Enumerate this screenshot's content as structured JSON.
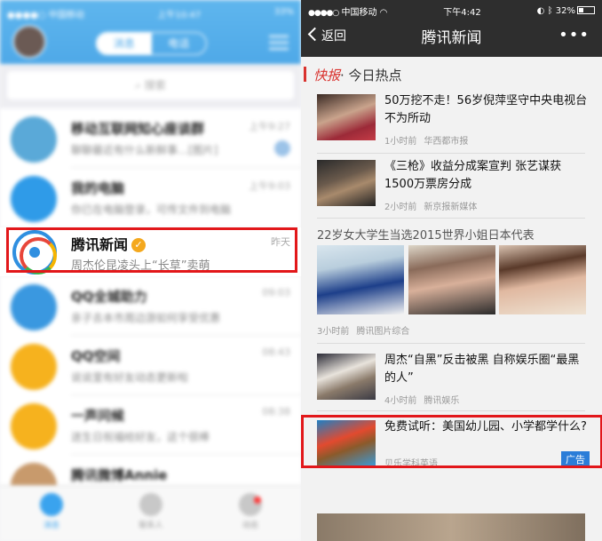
{
  "left": {
    "status": {
      "carrier": "●●●●○ 中国移动",
      "time": "上午10:47",
      "battery": "33%"
    },
    "segment": [
      "消息",
      "电话"
    ],
    "search_placeholder": "搜索",
    "items": [
      {
        "name": "移动互联网知心座谈群",
        "msg": "聊聊最近有什么新鲜事…[图片]",
        "time": "上午9:27"
      },
      {
        "name": "我的电脑",
        "msg": "你已在电脑登录，可传文件到电脑",
        "time": "上午9:03"
      },
      {
        "name": "QQ全城助力",
        "msg": "亲子去本市周边游如何享受优惠",
        "time": "09:03"
      },
      {
        "name": "QQ空间",
        "msg": "说说里有好友动态更新啦",
        "time": "08:43"
      },
      {
        "name": "一声问候",
        "msg": "送生日祝福给好友，这个很棒",
        "time": "08:38"
      },
      {
        "name": "腾讯微博Annie",
        "msg": "",
        "time": ""
      }
    ],
    "focused": {
      "name": "腾讯新闻",
      "msg": "周杰伦昆凌头上“长草”卖萌",
      "time": "昨天"
    },
    "tabs": [
      "消息",
      "联系人",
      "动态"
    ]
  },
  "right": {
    "status": {
      "carrier": "中国移动",
      "signal": "●●●●○",
      "time": "下午4:42",
      "battery": "32%"
    },
    "nav": {
      "back": "返回",
      "title": "腾讯新闻",
      "more": "•••"
    },
    "section": {
      "kuaibao": "快报",
      "title": "· 今日热点"
    },
    "news": [
      {
        "title": "50万挖不走！56岁倪萍坚守中央电视台不为所动",
        "time": "1小时前",
        "source": "华西都市报"
      },
      {
        "title": "《三枪》收益分成案宣判 张艺谋获1500万票房分成",
        "time": "2小时前",
        "source": "新京报新媒体"
      },
      {
        "title": "周杰“自黑”反击被黑 自称娱乐圈“最黑的人”",
        "time": "4小时前",
        "source": "腾讯娱乐"
      }
    ],
    "gallery": {
      "title": "22岁女大学生当选2015世界小姐日本代表",
      "time": "3小时前",
      "source": "腾讯图片综合"
    },
    "ad": {
      "title": "免费试听：美国幼儿园、小学都学什么?",
      "source": "贝乐学科英语",
      "tag": "广告"
    }
  }
}
